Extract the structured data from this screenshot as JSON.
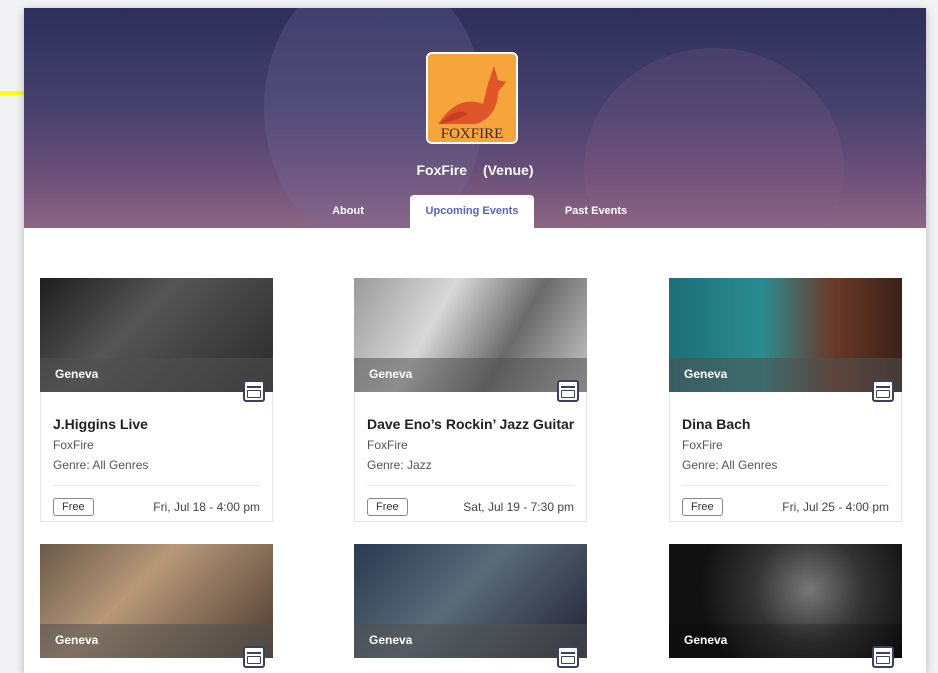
{
  "venue": {
    "name": "FoxFire",
    "type": "(Venue)",
    "logo_text": "FOXFIRE"
  },
  "tabs": [
    {
      "label": "About"
    },
    {
      "label": "Upcoming Events"
    },
    {
      "label": "Past Events"
    }
  ],
  "events": [
    {
      "city": "Geneva",
      "title": "J.Higgins Live",
      "venue": "FoxFire",
      "genre": "Genre: All Genres",
      "price": "Free",
      "when": "Fri, Jul 18 - 4:00 pm"
    },
    {
      "city": "Geneva",
      "title": "Dave Eno’s Rockin’ Jazz Guitar",
      "venue": "FoxFire",
      "genre": "Genre: Jazz",
      "price": "Free",
      "when": "Sat, Jul 19 - 7:30 pm"
    },
    {
      "city": "Geneva",
      "title": "Dina Bach",
      "venue": "FoxFire",
      "genre": "Genre: All Genres",
      "price": "Free",
      "when": "Fri, Jul 25 - 4:00 pm"
    },
    {
      "city": "Geneva"
    },
    {
      "city": "Geneva"
    },
    {
      "city": "Geneva"
    }
  ],
  "colors": {
    "accent": "#5a63b8",
    "arrow": "#ffff00",
    "hero_top": "#2e2f5c",
    "hero_bottom": "#8d6582"
  }
}
